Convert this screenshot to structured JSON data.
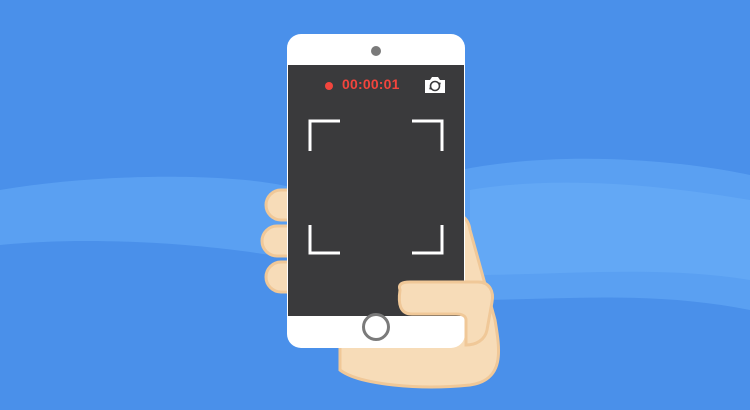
{
  "recording": {
    "time": "00:00:01",
    "status_color": "#f2453d"
  },
  "icons": {
    "record": "record-dot-icon",
    "switch_camera": "camera-switch-icon",
    "focus_frame": "viewfinder-icon",
    "home": "home-button"
  },
  "colors": {
    "background": "#4a90ea",
    "wave": "#5aa0f2",
    "phone_body": "#ffffff",
    "screen": "#3a3a3c",
    "skin": "#f7dcb8",
    "skin_outline": "#f0c898"
  }
}
